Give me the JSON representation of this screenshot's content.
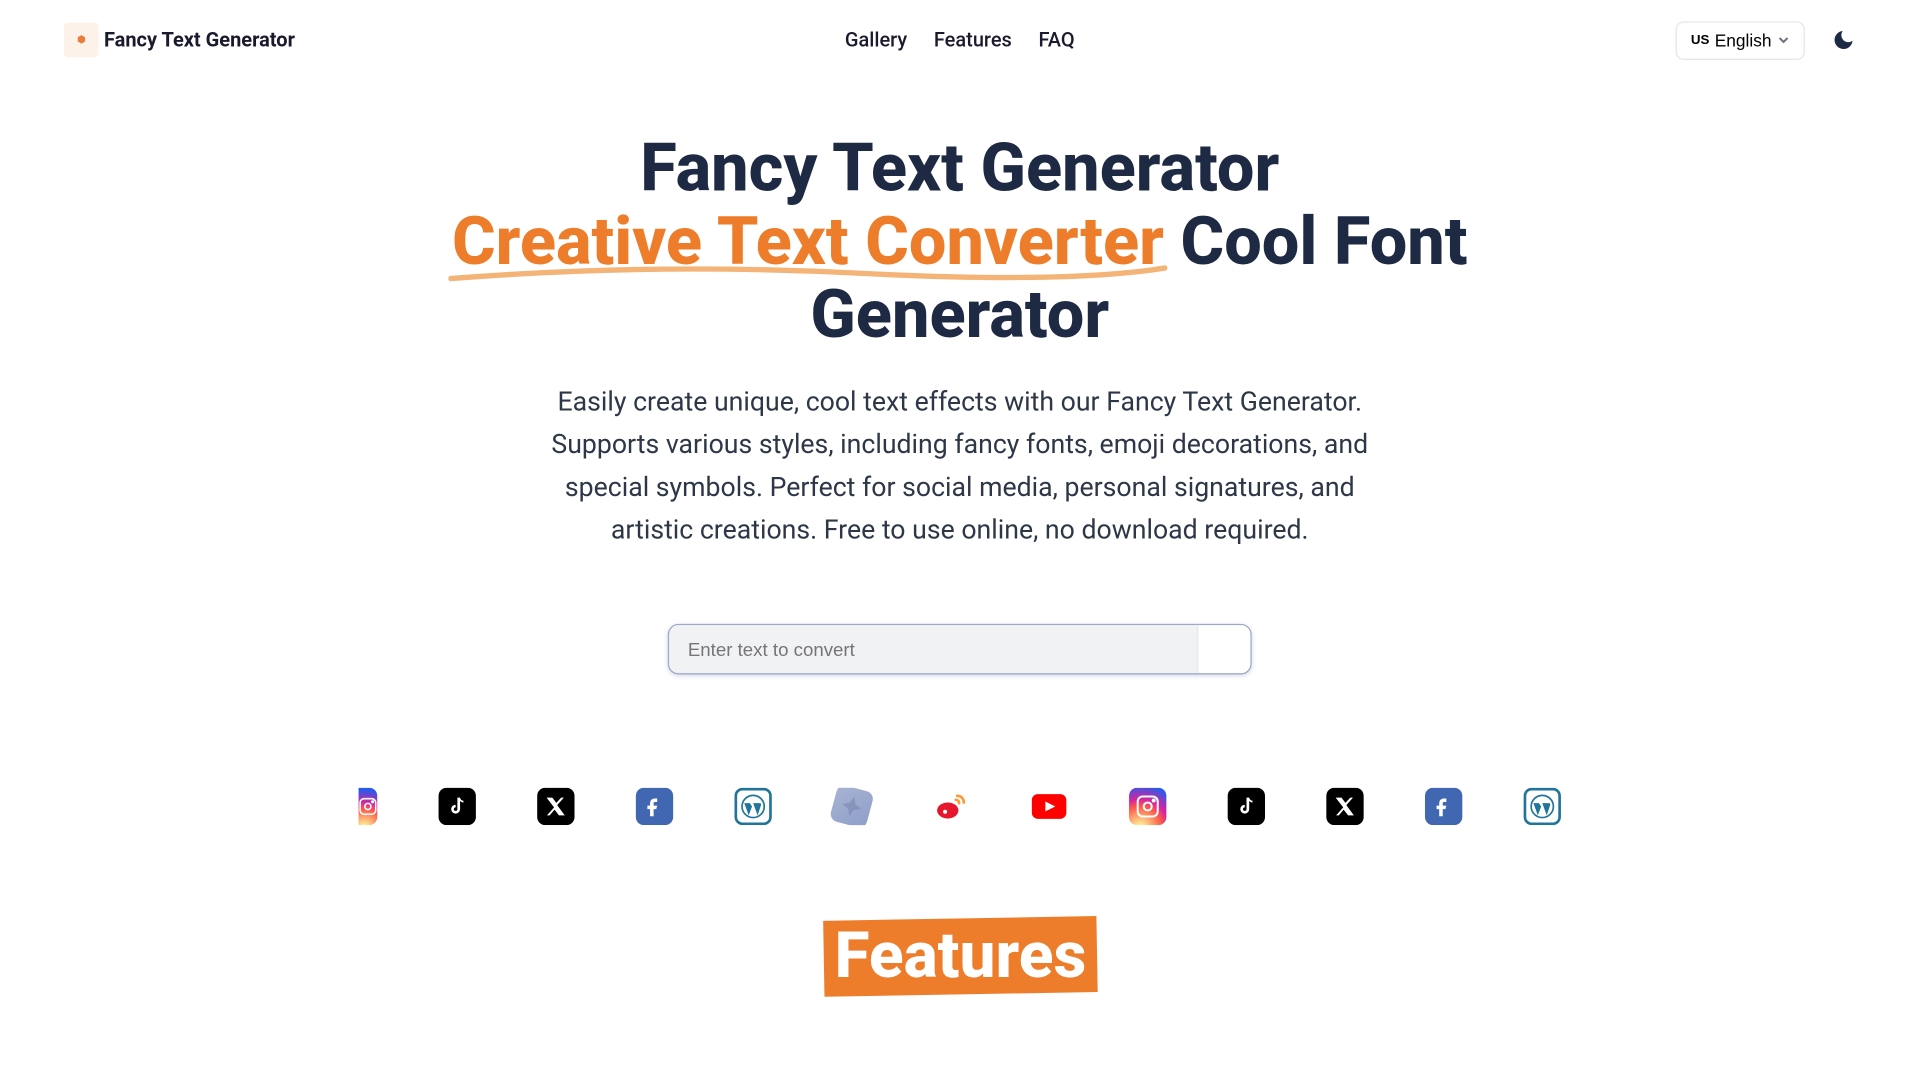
{
  "header": {
    "logo_text": "Fancy Text Generator",
    "nav": {
      "gallery": "Gallery",
      "features": "Features",
      "faq": "FAQ"
    },
    "lang": {
      "flag": "US",
      "label": "English"
    }
  },
  "hero": {
    "title_line1": "Fancy Text Generator",
    "title_highlight": "Creative Text Converter",
    "title_line2_rest": " Cool Font Generator",
    "description": "Easily create unique, cool text effects with our Fancy Text Generator. Supports various styles, including fancy fonts, emoji decorations, and special symbols. Perfect for social media, personal signatures, and artistic creations. Free to use online, no download required."
  },
  "input": {
    "placeholder": "Enter text to convert"
  },
  "features": {
    "title": "Features"
  }
}
